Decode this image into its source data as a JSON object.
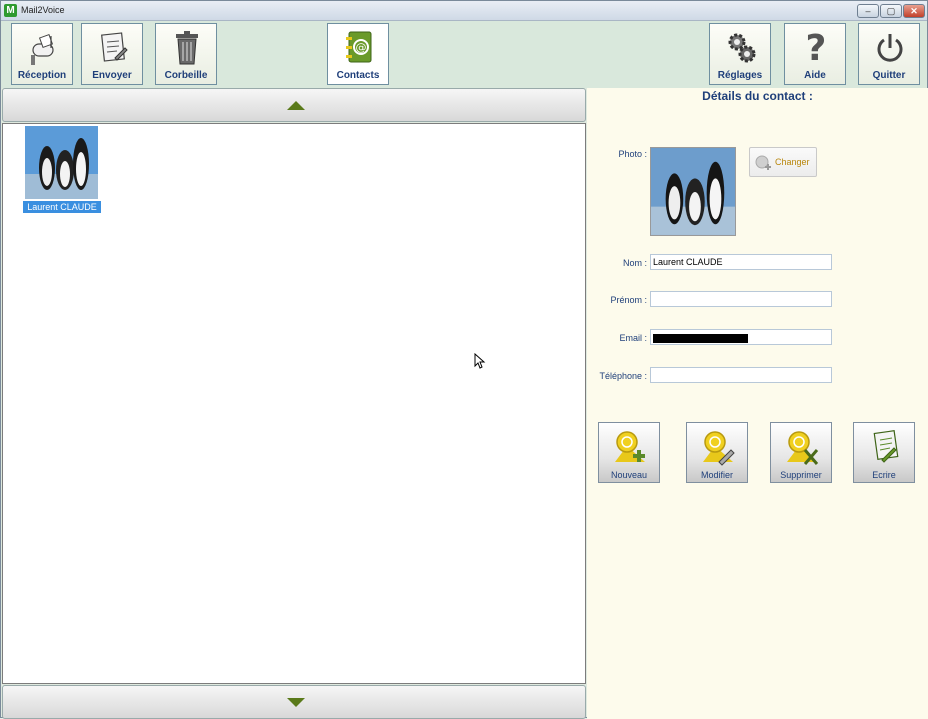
{
  "window": {
    "title": "Mail2Voice",
    "app_icon_letter": "M",
    "min": "–",
    "max": "▢",
    "close": "✕"
  },
  "toolbar": {
    "reception": "Réception",
    "envoyer": "Envoyer",
    "corbeille": "Corbeille",
    "contacts": "Contacts",
    "reglages": "Réglages",
    "aide": "Aide",
    "quitter": "Quitter"
  },
  "contacts": [
    {
      "name": "Laurent CLAUDE",
      "selected": true
    }
  ],
  "details": {
    "title": "Détails du contact :",
    "photo_label": "Photo :",
    "change_label": "Changer",
    "nom_label": "Nom :",
    "nom_value": "Laurent CLAUDE",
    "prenom_label": "Prénom :",
    "prenom_value": "",
    "email_label": "Email :",
    "email_value": "",
    "telephone_label": "Téléphone :",
    "telephone_value": ""
  },
  "actions": {
    "nouveau": "Nouveau",
    "modifier": "Modifier",
    "supprimer": "Supprimer",
    "ecrire": "Ecrire"
  },
  "colors": {
    "accent_text": "#1f3f7a",
    "toolbar_bg": "#d9e8dc",
    "details_bg": "#fdfbec",
    "icon_yellow": "#e8c81a",
    "icon_green": "#5a8a2a",
    "selection": "#3a8fe0"
  }
}
